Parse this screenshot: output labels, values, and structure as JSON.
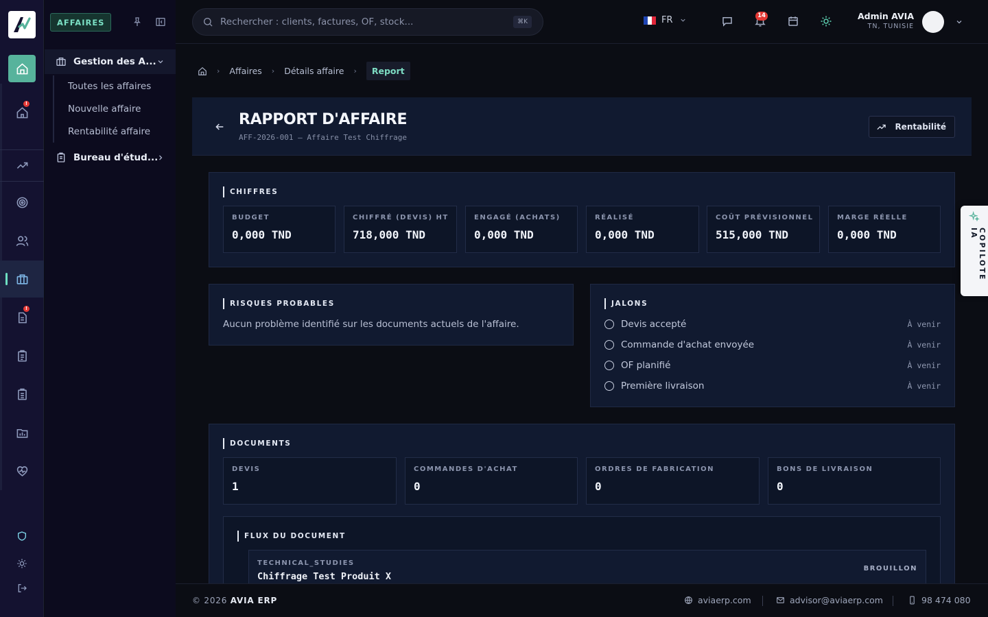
{
  "colors": {
    "accent": "#57b39c",
    "accent_text": "#7ddcc3",
    "panel": "#111a30",
    "badge": "#e53935"
  },
  "sidebar": {
    "module_label": "AFFAIRES",
    "groups": [
      {
        "label": "Gestion des A...",
        "icon": "briefcase-icon",
        "items": [
          "Toutes les affaires",
          "Nouvelle affaire",
          "Rentabilité affaire"
        ]
      },
      {
        "label": "Bureau d'étud...",
        "icon": "clipboard-icon"
      }
    ]
  },
  "header": {
    "search_placeholder": "Rechercher : clients, factures, OF, stock...",
    "search_shortcut": "⌘K",
    "language": "FR",
    "notification_count": "14",
    "user_name": "Admin AVIA",
    "user_location": "TN, TUNISIE"
  },
  "breadcrumb": [
    "Affaires",
    "Détails affaire",
    "Report"
  ],
  "page": {
    "title": "RAPPORT D'AFFAIRE",
    "subtitle": "AFF-2026-001 — Affaire Test Chiffrage",
    "action_button": "Rentabilité"
  },
  "chiffres": {
    "title": "CHIFFRES",
    "kpis": [
      {
        "label": "BUDGET",
        "value": "0,000 TND"
      },
      {
        "label": "CHIFFRÉ (DEVIS) HT",
        "value": "718,000 TND"
      },
      {
        "label": "ENGAGÉ (ACHATS)",
        "value": "0,000 TND"
      },
      {
        "label": "RÉALISÉ",
        "value": "0,000 TND"
      },
      {
        "label": "COÛT PRÉVISIONNEL",
        "value": "515,000 TND"
      },
      {
        "label": "MARGE RÉELLE",
        "value": "0,000 TND"
      }
    ]
  },
  "risques": {
    "title": "RISQUES PROBABLES",
    "text": "Aucun problème identifié sur les documents actuels de l'affaire."
  },
  "jalons": {
    "title": "JALONS",
    "items": [
      {
        "label": "Devis accepté",
        "status": "À venir"
      },
      {
        "label": "Commande d'achat envoyée",
        "status": "À venir"
      },
      {
        "label": "OF planifié",
        "status": "À venir"
      },
      {
        "label": "Première livraison",
        "status": "À venir"
      }
    ]
  },
  "documents": {
    "title": "DOCUMENTS",
    "counts": [
      {
        "label": "DEVIS",
        "value": "1"
      },
      {
        "label": "COMMANDES D'ACHAT",
        "value": "0"
      },
      {
        "label": "ORDRES DE FABRICATION",
        "value": "0"
      },
      {
        "label": "BONS DE LIVRAISON",
        "value": "0"
      }
    ],
    "flux_title": "FLUX DU DOCUMENT",
    "flux_items": [
      {
        "type": "TECHNICAL_STUDIES",
        "name": "Chiffrage Test Produit X",
        "status": "BROUILLON"
      }
    ]
  },
  "copilot_label": "COPILOTE IA",
  "footer": {
    "year": "© 2026",
    "brand": "AVIA ERP",
    "website": "aviaerp.com",
    "email": "advisor@aviaerp.com",
    "phone": "98 474 080"
  }
}
